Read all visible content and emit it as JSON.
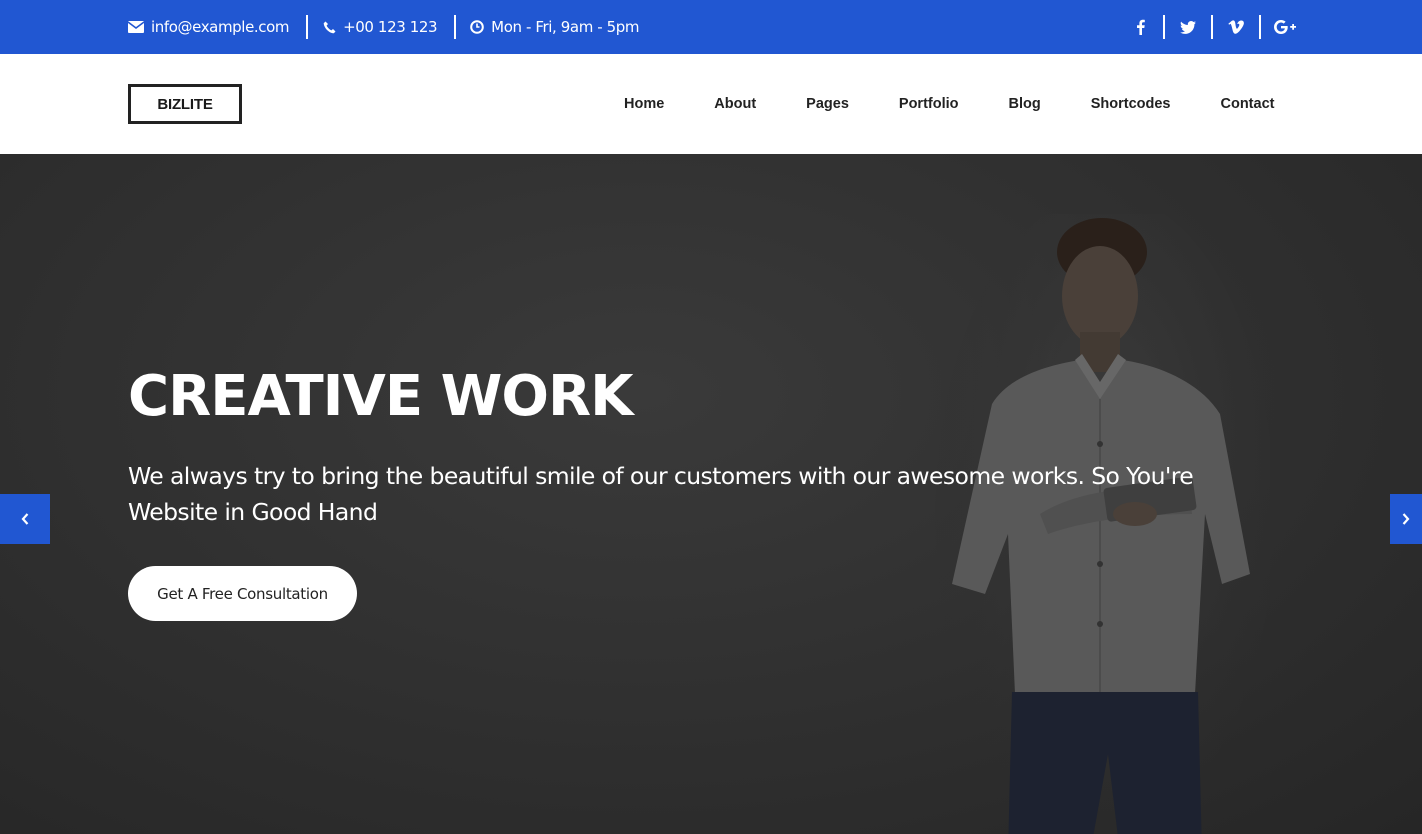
{
  "topbar": {
    "email": "info@example.com",
    "phone": "+00 123 123",
    "hours": "Mon - Fri, 9am - 5pm",
    "icons": [
      "envelope-icon",
      "phone-icon",
      "clock-icon"
    ],
    "social": [
      "facebook-icon",
      "twitter-icon",
      "vimeo-icon",
      "google-plus-icon"
    ]
  },
  "header": {
    "logo": "BIZLITE",
    "nav": [
      "Home",
      "About",
      "Pages",
      "Portfolio",
      "Blog",
      "Shortcodes",
      "Contact"
    ]
  },
  "hero": {
    "title": "CREATIVE WORK",
    "subtitle": "We always try to bring the beautiful smile of our customers with our awesome works. So You're Website in Good Hand",
    "cta_label": "Get A Free Consultation"
  },
  "colors": {
    "brand_blue": "#2157d2",
    "hero_bg": "#2e2e2e",
    "white": "#ffffff"
  }
}
